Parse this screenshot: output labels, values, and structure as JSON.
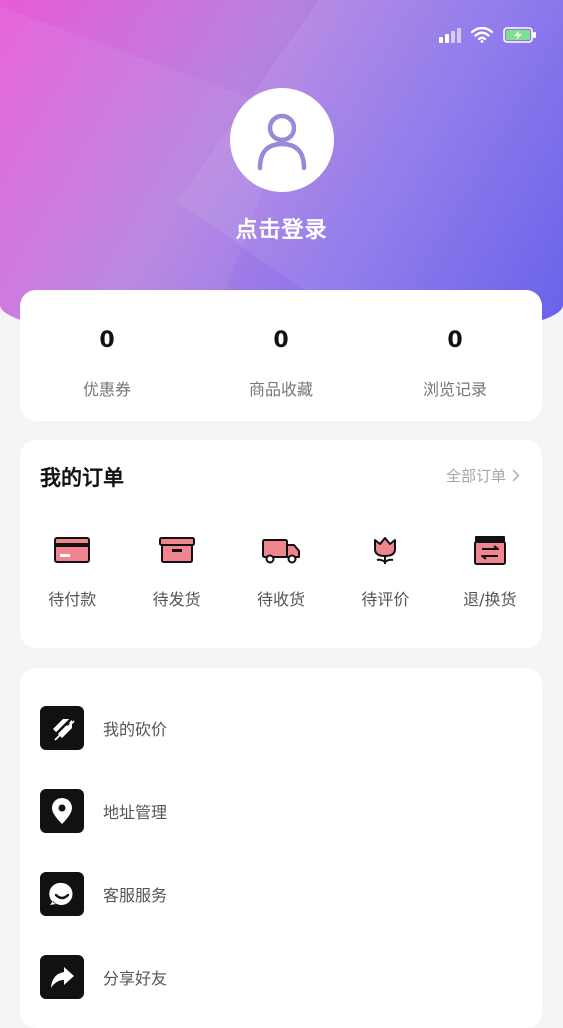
{
  "login": {
    "text": "点击登录"
  },
  "stats": [
    {
      "value": "0",
      "label": "优惠券"
    },
    {
      "value": "0",
      "label": "商品收藏"
    },
    {
      "value": "0",
      "label": "浏览记录"
    }
  ],
  "orders": {
    "title": "我的订单",
    "all_label": "全部订单",
    "items": [
      {
        "label": "待付款",
        "icon": "card-icon"
      },
      {
        "label": "待发货",
        "icon": "box-icon"
      },
      {
        "label": "待收货",
        "icon": "truck-icon"
      },
      {
        "label": "待评价",
        "icon": "flower-icon"
      },
      {
        "label": "退/换货",
        "icon": "exchange-icon"
      }
    ]
  },
  "menu": [
    {
      "label": "我的砍价",
      "icon": "price-tag-icon"
    },
    {
      "label": "地址管理",
      "icon": "location-pin-icon"
    },
    {
      "label": "客服服务",
      "icon": "chat-smile-icon"
    },
    {
      "label": "分享好友",
      "icon": "share-arrow-icon"
    }
  ],
  "colors": {
    "gradient_start": "#e85bd9",
    "gradient_end": "#5a54e9",
    "accent_icon": "#f0858f",
    "avatar_icon": "#9a88d8"
  }
}
